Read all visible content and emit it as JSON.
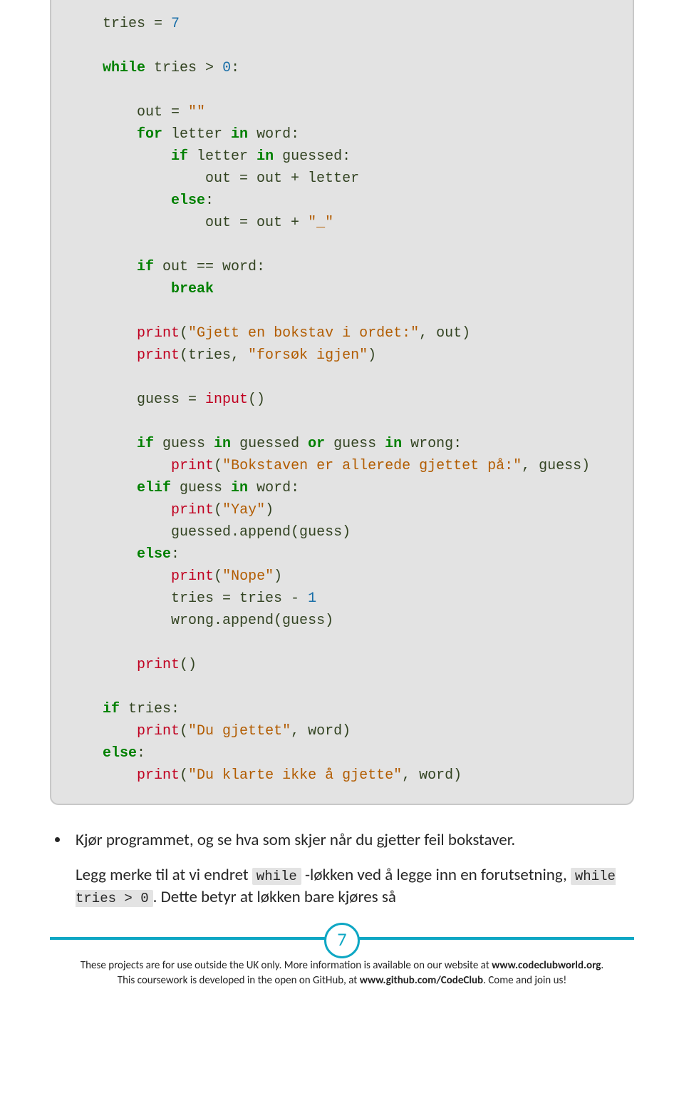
{
  "code": {
    "l1_a": "tries = ",
    "l1_num": "7",
    "l2_kw": "while",
    "l2_b": " tries > ",
    "l2_num": "0",
    "l2_c": ":",
    "l3_a": "out = ",
    "l3_str": "\"\"",
    "l4_kw": "for",
    "l4_a": " letter ",
    "l4_kw2": "in",
    "l4_b": " word:",
    "l5_kw": "if",
    "l5_a": " letter ",
    "l5_kw2": "in",
    "l5_b": " guessed:",
    "l6_a": "out = out + letter",
    "l7_kw": "else",
    "l7_a": ":",
    "l8_a": "out = out + ",
    "l8_str": "\"_\"",
    "l9_kw": "if",
    "l9_a": " out == word:",
    "l10_kw": "break",
    "l11_fn": "print",
    "l11_a": "(",
    "l11_str": "\"Gjett en bokstav i ordet:\"",
    "l11_b": ", out)",
    "l12_fn": "print",
    "l12_a": "(tries, ",
    "l12_str": "\"forsøk igjen\"",
    "l12_b": ")",
    "l13_a": "guess = ",
    "l13_fn": "input",
    "l13_b": "()",
    "l14_kw": "if",
    "l14_a": " guess ",
    "l14_kw2": "in",
    "l14_b": " guessed ",
    "l14_kw3": "or",
    "l14_c": " guess ",
    "l14_kw4": "in",
    "l14_d": " wrong:",
    "l15_fn": "print",
    "l15_a": "(",
    "l15_str": "\"Bokstaven er allerede gjettet på:\"",
    "l15_b": ", guess)",
    "l16_kw": "elif",
    "l16_a": " guess ",
    "l16_kw2": "in",
    "l16_b": " word:",
    "l17_fn": "print",
    "l17_a": "(",
    "l17_str": "\"Yay\"",
    "l17_b": ")",
    "l18_a": "guessed.append(guess)",
    "l19_kw": "else",
    "l19_a": ":",
    "l20_fn": "print",
    "l20_a": "(",
    "l20_str": "\"Nope\"",
    "l20_b": ")",
    "l21_a": "tries = tries - ",
    "l21_num": "1",
    "l22_a": "wrong.append(guess)",
    "l23_fn": "print",
    "l23_a": "()",
    "l24_kw": "if",
    "l24_a": " tries:",
    "l25_fn": "print",
    "l25_a": "(",
    "l25_str": "\"Du gjettet\"",
    "l25_b": ", word)",
    "l26_kw": "else",
    "l26_a": ":",
    "l27_fn": "print",
    "l27_a": "(",
    "l27_str": "\"Du klarte ikke å gjette\"",
    "l27_b": ", word)"
  },
  "body": {
    "bullet1": "Kjør programmet, og se hva som skjer når du gjetter feil bokstaver.",
    "p2_a": "Legg merke til at vi endret ",
    "p2_code1": "while",
    "p2_b": " -løkken ved å legge inn en forutsetning, ",
    "p2_code2": "while tries > 0",
    "p2_c": ". Dette betyr at løkken bare kjøres så"
  },
  "page_number": "7",
  "footer": {
    "line1_a": "These projects are for use outside the UK only. More information is available on our website at ",
    "line1_b": "www.codeclubworld.org",
    "line1_c": ".",
    "line2_a": "This coursework is developed in the open on GitHub, at ",
    "line2_b": "www.github.com/CodeClub",
    "line2_c": ". Come and join us!"
  }
}
